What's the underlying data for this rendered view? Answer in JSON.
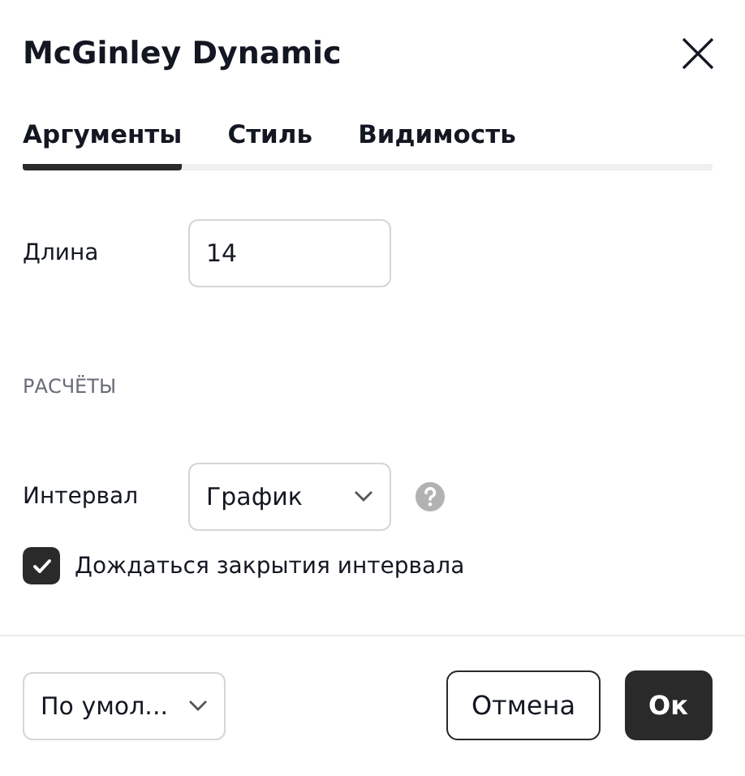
{
  "dialog": {
    "title": "McGinley Dynamic"
  },
  "tabs": [
    {
      "label": "Аргументы",
      "selected": true
    },
    {
      "label": "Стиль",
      "selected": false
    },
    {
      "label": "Видимость",
      "selected": false
    }
  ],
  "fields": [
    {
      "label": "Длина",
      "kind": "input",
      "value": "14"
    }
  ],
  "section": {
    "title": "РАСЧЁТЫ"
  },
  "section_fields": [
    {
      "label": "Интервал",
      "kind": "select",
      "value": "График",
      "help": true
    }
  ],
  "checkbox": {
    "label": "Дождаться закрытия интервала",
    "checked": true
  },
  "footer": {
    "preset": "По умол...",
    "buttons": [
      {
        "label": "Отмена",
        "kind": "secondary"
      },
      {
        "label": "Ок",
        "kind": "primary"
      }
    ]
  }
}
